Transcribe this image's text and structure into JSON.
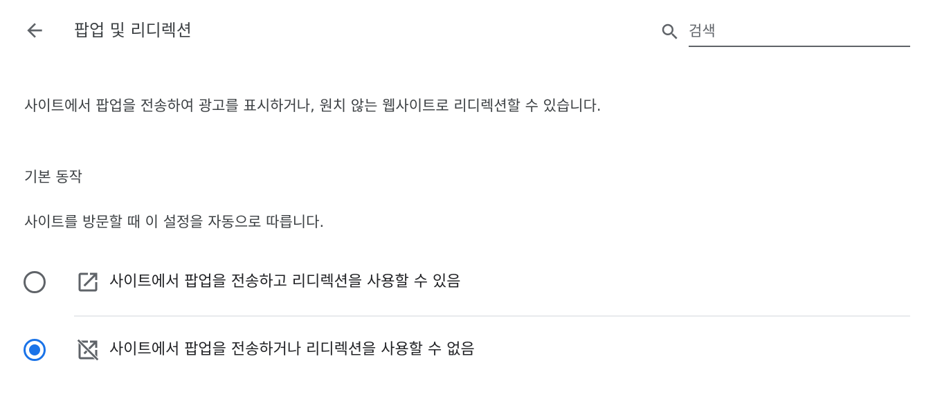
{
  "header": {
    "title": "팝업 및 리디렉션",
    "back_icon": "arrow-back-icon"
  },
  "search": {
    "placeholder": "검색",
    "value": "",
    "icon": "search-icon"
  },
  "description": "사이트에서 팝업을 전송하여 광고를 표시하거나, 원치 않는 웹사이트로 리디렉션할 수 있습니다.",
  "default_behavior": {
    "heading": "기본 동작",
    "subtext": "사이트를 방문할 때 이 설정을 자동으로 따릅니다.",
    "options": [
      {
        "label": "사이트에서 팝업을 전송하고 리디렉션을 사용할 수 있음",
        "icon": "open-in-new-icon",
        "selected": false
      },
      {
        "label": "사이트에서 팝업을 전송하거나 리디렉션을 사용할 수 없음",
        "icon": "open-in-new-off-icon",
        "selected": true
      }
    ]
  },
  "colors": {
    "accent": "#1a73e8",
    "text_primary": "#202124",
    "text_secondary": "#3c4043",
    "icon": "#5f6368",
    "divider": "#e8eaed"
  }
}
